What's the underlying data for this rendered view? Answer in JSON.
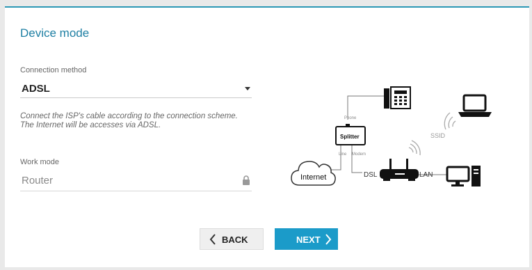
{
  "page": {
    "title": "Device mode"
  },
  "connection": {
    "label": "Connection method",
    "value": "ADSL"
  },
  "hint": {
    "line1": "Connect the ISP's cable according to the connection scheme.",
    "line2": "The Internet will be accesses via ADSL."
  },
  "work_mode": {
    "label": "Work mode",
    "value": "Router"
  },
  "buttons": {
    "back": "BACK",
    "next": "NEXT"
  },
  "diagram": {
    "phone": "Phone",
    "splitter": "Splitter",
    "line": "Line",
    "modem": "Modem",
    "internet": "Internet",
    "dsl": "DSL",
    "lan": "LAN",
    "ssid": "SSID"
  },
  "colors": {
    "accent": "#1b9bc9",
    "title": "#1e7fa3",
    "top_border": "#2b97b5"
  },
  "icons": [
    "chevron-down-icon",
    "lock-icon",
    "chevron-left-icon",
    "chevron-right-icon",
    "phone-icon",
    "laptop-icon",
    "desktop-icon",
    "router-icon",
    "cloud-icon",
    "wifi-icon"
  ]
}
